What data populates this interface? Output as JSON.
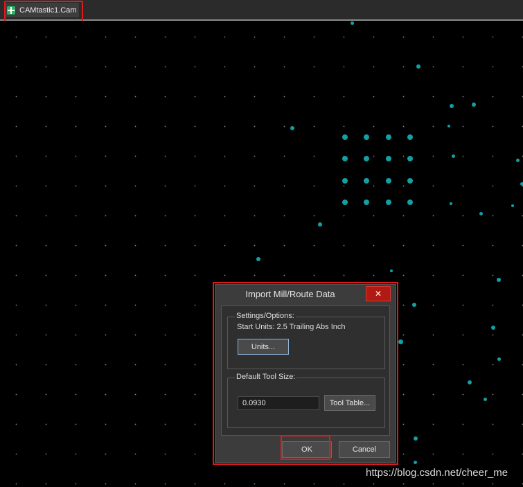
{
  "document_tab": {
    "icon": "camtastic-document-icon",
    "label": "CAMtastic1.Cam",
    "highlight_color": "#e0191c"
  },
  "canvas": {
    "background": "#000000",
    "grid_dot_color": "#8a8a8a",
    "pad_color": "#13a0a5"
  },
  "dialog": {
    "title": "Import Mill/Route Data",
    "close_label": "✕",
    "settings_group": {
      "label": "Settings/Options:",
      "start_units_text": "Start Units: 2.5 Trailing Abs Inch",
      "units_button_label": "Units..."
    },
    "tool_group": {
      "label": "Default Tool Size:",
      "tool_size_value": "0.0930",
      "tool_table_button_label": "Tool Table..."
    },
    "ok_label": "OK",
    "cancel_label": "Cancel"
  },
  "watermark": "https://blog.csdn.net/cheer_me"
}
